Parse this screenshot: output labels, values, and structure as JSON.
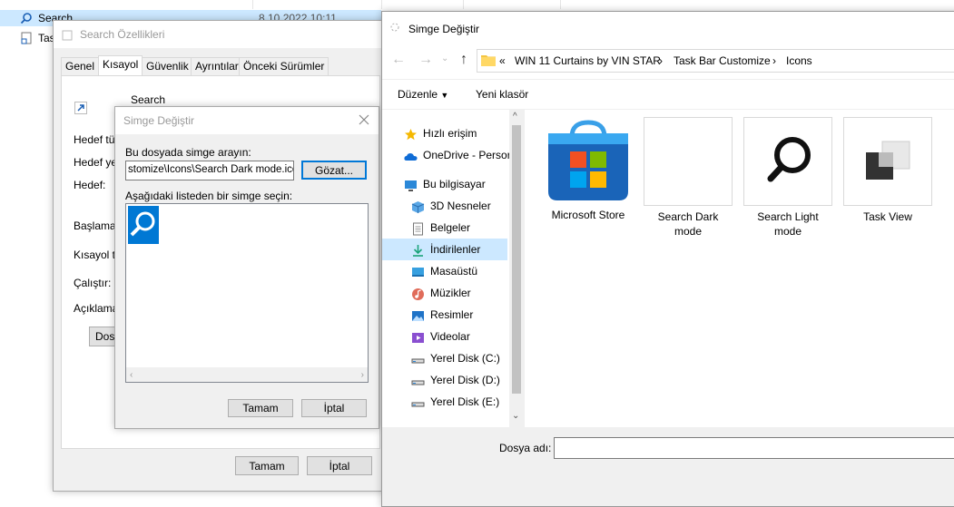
{
  "background": {
    "rows": [
      {
        "name": "Search",
        "date": "8.10.2022 10:11"
      },
      {
        "name": "Task View",
        "date": ""
      }
    ]
  },
  "properties": {
    "title": "Search Özellikleri",
    "tabs": [
      "Genel",
      "Kısayol",
      "Güvenlik",
      "Ayrıntılar",
      "Önceki Sürümler"
    ],
    "active_tab": "Kısayol",
    "shortcut_name": "Search",
    "fields": [
      "Hedef tür:",
      "Hedef yer",
      "Hedef:",
      "Başlama y",
      "Kısayol tu",
      "Çalıştır:",
      "Açıklama:"
    ],
    "open_file_button": "Dosy",
    "ok": "Tamam",
    "cancel": "İptal"
  },
  "change_icon_small": {
    "title": "Simge Değiştir",
    "search_label": "Bu dosyada simge arayın:",
    "path_value": "stomize\\Icons\\Search Dark mode.ico",
    "browse": "Gözat...",
    "list_label": "Aşağıdaki listeden bir simge seçin:",
    "ok": "Tamam",
    "cancel": "İptal"
  },
  "file_dialog": {
    "title": "Simge Değiştir",
    "breadcrumb": [
      "WIN 11 Curtains by VIN STAR",
      "Task Bar Customize",
      "Icons"
    ],
    "breadcrumb_prefix": "«",
    "organize": "Düzenle",
    "new_folder": "Yeni klasör",
    "nav": [
      {
        "label": "Hızlı erişim",
        "icon": "star-icon",
        "indent": 0
      },
      {
        "label": "OneDrive - Persor",
        "icon": "cloud-icon",
        "indent": 0
      },
      {
        "label": "Bu bilgisayar",
        "icon": "computer-icon",
        "indent": 0
      },
      {
        "label": "3D Nesneler",
        "icon": "cube-icon",
        "indent": 1
      },
      {
        "label": "Belgeler",
        "icon": "document-icon",
        "indent": 1
      },
      {
        "label": "İndirilenler",
        "icon": "download-icon",
        "indent": 1
      },
      {
        "label": "Masaüstü",
        "icon": "desktop-icon",
        "indent": 1
      },
      {
        "label": "Müzikler",
        "icon": "music-icon",
        "indent": 1
      },
      {
        "label": "Resimler",
        "icon": "pictures-icon",
        "indent": 1
      },
      {
        "label": "Videolar",
        "icon": "video-icon",
        "indent": 1
      },
      {
        "label": "Yerel Disk (C:)",
        "icon": "drive-icon",
        "indent": 1
      },
      {
        "label": "Yerel Disk (D:)",
        "icon": "drive-icon",
        "indent": 1
      },
      {
        "label": "Yerel Disk (E:)",
        "icon": "drive-icon",
        "indent": 1
      }
    ],
    "selected_nav": "İndirilenler",
    "files": [
      {
        "name": "Microsoft Store",
        "icon": "store-icon"
      },
      {
        "name": "Search Dark mode",
        "icon": "blank-icon"
      },
      {
        "name": "Search Light mode",
        "icon": "search-icon"
      },
      {
        "name": "Task View",
        "icon": "task-view-icon"
      }
    ],
    "filename_label": "Dosya adı:",
    "filename_value": ""
  },
  "colors": {
    "accent": "#0078d7",
    "selection": "#cce8ff",
    "windows_blue": "#0078d4"
  }
}
